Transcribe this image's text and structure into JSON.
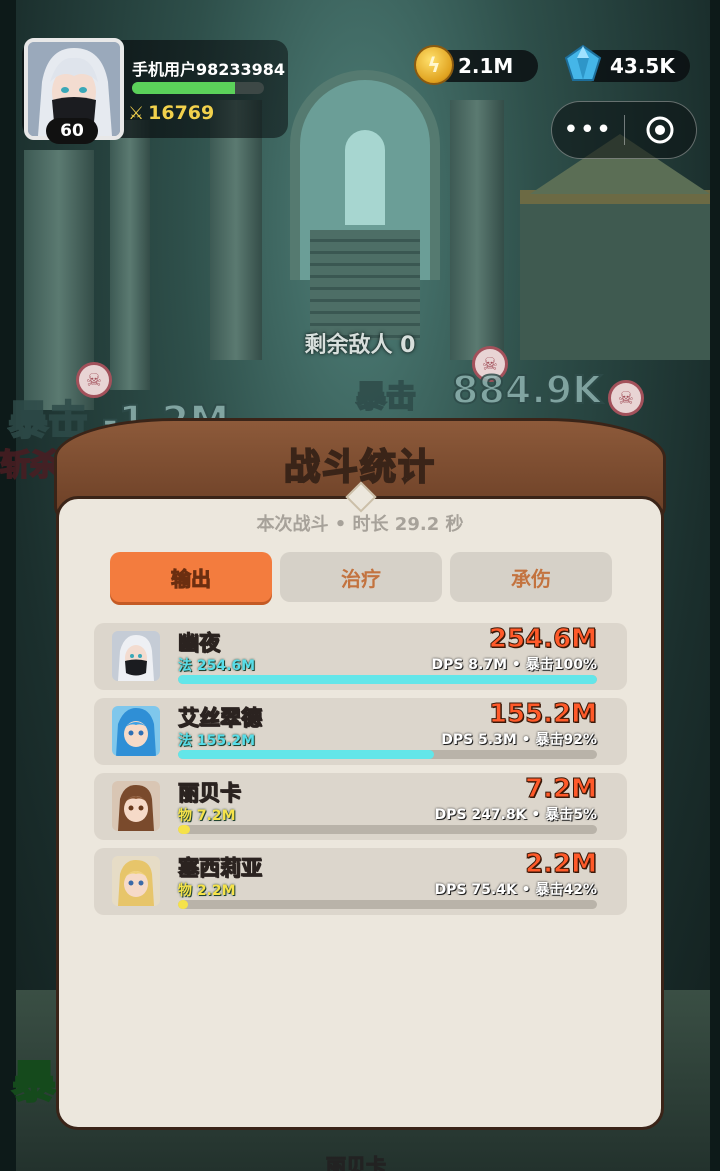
{
  "player": {
    "name": "手机用户98233984",
    "level": "60",
    "power": "16769",
    "xp_progress": 0.78
  },
  "currencies": {
    "coins": "2.1M",
    "gems": "43.5K"
  },
  "battle": {
    "enemies_remaining": "剩余敌人 0"
  },
  "combat_texts": [
    {
      "text": "暴击 -1.2M"
    },
    {
      "text": "斩杀"
    },
    {
      "text": "暴击"
    },
    {
      "text": "884.9K"
    },
    {
      "text": "暴"
    },
    {
      "text": "丽贝卡"
    }
  ],
  "stats_dialog": {
    "title": "战斗统计",
    "subtitle": "本次战斗 • 时长 29.2 秒",
    "tabs": [
      {
        "label": "输出",
        "active": true
      },
      {
        "label": "治疗",
        "active": false
      },
      {
        "label": "承伤",
        "active": false
      }
    ],
    "heroes": [
      {
        "name": "幽夜",
        "type_label": "法 254.6M",
        "total": "254.6M",
        "stats": "DPS 8.7M • 暴击100%",
        "share": 1.0,
        "bar_color": "#63e6e9",
        "sub_color": "#58dde8"
      },
      {
        "name": "艾丝翠德",
        "type_label": "法 155.2M",
        "total": "155.2M",
        "stats": "DPS 5.3M • 暴击92%",
        "share": 0.61,
        "bar_color": "#63e6e9",
        "sub_color": "#58dde8"
      },
      {
        "name": "丽贝卡",
        "type_label": "物 7.2M",
        "total": "7.2M",
        "stats": "DPS 247.8K • 暴击5%",
        "share": 0.028,
        "bar_color": "#f5e24a",
        "sub_color": "#f5e24a"
      },
      {
        "name": "塞西莉亚",
        "type_label": "物 2.2M",
        "total": "2.2M",
        "stats": "DPS 75.4K • 暴击42%",
        "share": 0.009,
        "bar_color": "#f5e24a",
        "sub_color": "#f5e24a"
      }
    ]
  },
  "colors": {
    "accent_tab": "#f37c3e",
    "damage_total": "#ff5a2a",
    "magic_bar": "#63e6e9",
    "physical_bar": "#f5e24a",
    "xp_bar": "#5bd15a"
  },
  "icons": {
    "coin": "coin-icon",
    "gem": "gem-icon",
    "power": "sword-icon",
    "menu": "more-icon",
    "close": "target-close-icon",
    "enemy_marker": "skull-icon"
  }
}
